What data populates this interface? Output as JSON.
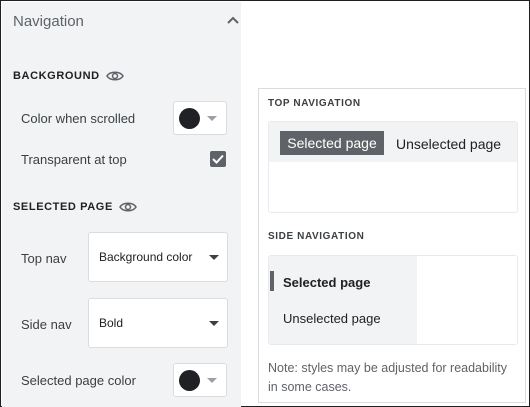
{
  "panel": {
    "title": "Navigation",
    "sections": {
      "background": {
        "title": "BACKGROUND",
        "color_when_scrolled_label": "Color when scrolled",
        "transparent_at_top_label": "Transparent at top",
        "transparent_at_top_checked": true,
        "color_when_scrolled_value": "#202124"
      },
      "selected_page": {
        "title": "SELECTED PAGE",
        "top_nav_label": "Top nav",
        "top_nav_value": "Background color",
        "side_nav_label": "Side nav",
        "side_nav_value": "Bold",
        "selected_page_color_label": "Selected page color",
        "selected_page_color_value": "#202124"
      }
    }
  },
  "preview": {
    "top_navigation_title": "TOP NAVIGATION",
    "top_selected": "Selected page",
    "top_unselected": "Unselected page",
    "side_navigation_title": "SIDE NAVIGATION",
    "side_selected": "Selected page",
    "side_unselected": "Unselected page",
    "note": "Note: styles may be adjusted for readability in some cases."
  }
}
